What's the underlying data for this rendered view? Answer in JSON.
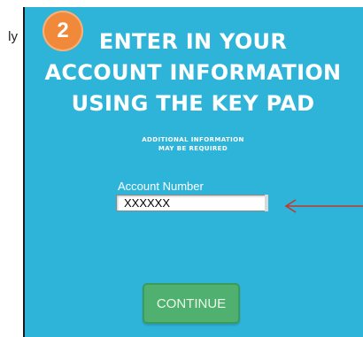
{
  "fragment": {
    "text": "ly"
  },
  "step": {
    "number": "2",
    "color": "#f08a3a"
  },
  "title": {
    "line1": "ENTER IN YOUR",
    "line2": "ACCOUNT INFORMATION",
    "line3": "USING THE KEY PAD"
  },
  "subtitle": {
    "line1": "ADDITIONAL INFORMATION",
    "line2": "MAY BE REQUIRED"
  },
  "account_field": {
    "label": "Account Number",
    "value": "XXXXXX"
  },
  "continue_button": {
    "label": "CONTINUE"
  },
  "colors": {
    "screen_bg": "#2fb4d9",
    "button_bg": "#4fb070",
    "arrow": "#c0392b"
  },
  "icons": {
    "pointer": "arrow-left-icon"
  }
}
